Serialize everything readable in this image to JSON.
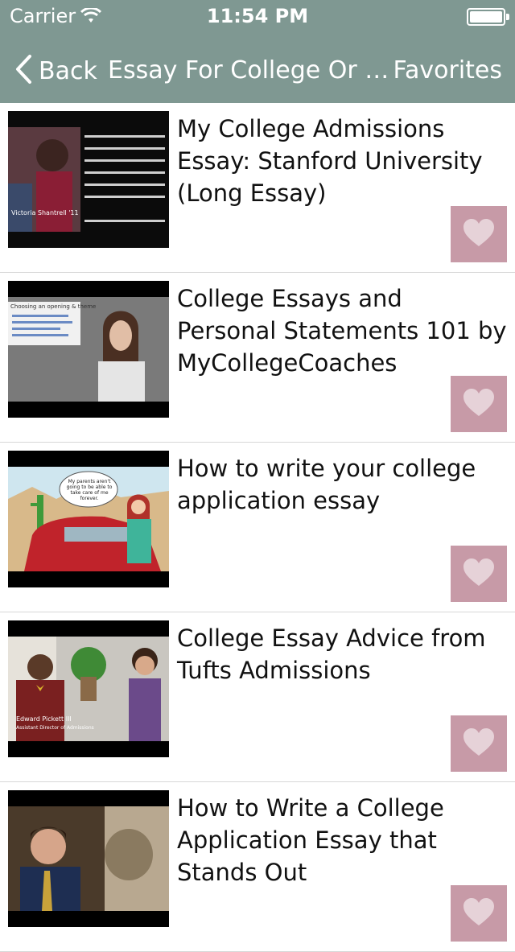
{
  "status": {
    "carrier": "Carrier",
    "time": "11:54 PM"
  },
  "nav": {
    "back_label": "Back",
    "title": "Essay For College Or Unive...",
    "favorites_label": "Favorites"
  },
  "videos": [
    {
      "title": "My College Admissions Essay: Stanford University (Long Essay)",
      "thumb_caption": "Victoria Shantrell '11"
    },
    {
      "title": "College Essays and Personal Statements 101 by MyCollegeCoaches",
      "thumb_caption": "Choosing an opening & theme"
    },
    {
      "title": "How to write your college application essay",
      "thumb_caption": "My parents aren't going to be able to take care of me forever."
    },
    {
      "title": "College Essay Advice from Tufts Admissions",
      "thumb_caption": "Edward Pickett III",
      "thumb_subcaption": "Assistant Director of Admissions"
    },
    {
      "title": "How to Write a College Application Essay that Stands Out",
      "thumb_caption": ""
    }
  ],
  "colors": {
    "nav_bg": "#7f9892",
    "heart_bg": "#c79aa7",
    "heart_fg": "#e6d2d8"
  }
}
